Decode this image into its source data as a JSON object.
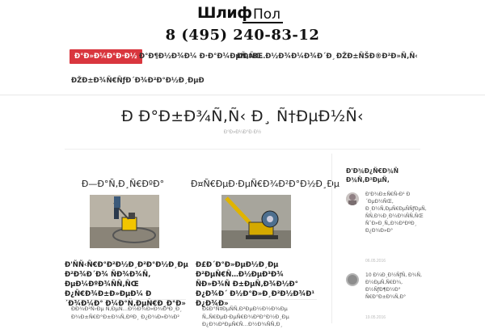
{
  "header": {
    "logo_left": "Шлиф",
    "logo_right": "Пол",
    "phone": "8 (495) 240-83-12"
  },
  "nav": [
    {
      "label": "Ð°Ð»Ð¼Ð°Ð·Ð½",
      "active": true
    },
    {
      "label": "Ð°Ð¶Ð½Ð¾Ð¼ Ð·Ð°Ð¼ÐµÑ‚ÑŒ",
      "active": false
    },
    {
      "label": "ÐÐ¤Ð…Ð½Ð¾Ð¼Ð¾Ð´Ð¸",
      "active": false
    },
    {
      "label": "ÐŽÐ±ÑŠÐ®Ð²Ð»Ñ‚Ñ‹",
      "active": false
    },
    {
      "label": "ÐŽÐ±Ð¾Ñ€ÑƒÐ´Ð¾Ð²Ð°Ð½Ð¸ÐµÐ",
      "active": false
    }
  ],
  "page": {
    "title": "Ð Ð°Ð±Ð¾Ñ‚Ñ‹ Ð¸ Ñ†ÐµÐ½Ñ‹",
    "breadcrumb": "Ð°Ð»Ð¼Ð°Ð·Ð½"
  },
  "cards": [
    {
      "title": "Ð—Ð°Ñ‚Ð¸Ñ€ÐºÐ°",
      "post_title": "Ð'ÑÑ‹Ñ€Ð°Ð²Ð½Ð¸Ð²Ð°Ð½Ð¸Ðµ Ð²Ð¾Ð´Ð¾ ÑÐ¾Ð¾Ñ‚ ÐµÐ¼ÐºÐ¾ÑÑ‚ÑŒ Ð¿Ñ€Ð¾Ð±Ð»ÐµÐ¼ Ð´Ð¾Ð¼Ð° Ð¼Ð°Ñ‚ÐµÑ€Ð¸Ð°Ð»",
      "excerpt": "ÐÐ¾Ð²Ñ‹Ðµ Ñ‚ÐµÑ…Ð½Ð¾Ð»Ð¾Ð³Ð¸Ð¸ Ð¾Ð±Ñ€Ð°Ð±Ð¾Ñ‚ÐºÐ¸ Ð¿Ð¾Ð»Ð¾Ð²"
    },
    {
      "title": "Ð¤Ñ€ÐµÐ·ÐµÑ€Ð¾Ð²Ð°Ð½Ð¸Ðµ",
      "post_title": "Ð£Ð´Ð°Ð»ÐµÐ½Ð¸Ðµ Ð²ÐµÑ€Ñ…Ð½ÐµÐ³Ð¾ ÑÐ»Ð¾Ñ Ð±ÐµÑ‚Ð¾Ð½Ð° Ð¿Ð¾Ð´ Ð½Ð°Ð»Ð¸Ð²Ð½Ð¾Ð¹ Ð¿Ð¾Ð»",
      "excerpt": "ÐšÐ°Ñ‡ÐµÑÑ‚Ð²ÐµÐ½Ð½Ð¾Ðµ Ñ„Ñ€ÐµÐ·ÐµÑ€Ð¾Ð²Ð°Ð½Ð¸Ðµ Ð¿Ð¾Ð²ÐµÑ€Ñ…Ð½Ð¾ÑÑ‚Ð¸"
    }
  ],
  "sidebar": {
    "widget_title": "Ð'Ð¾Ð¿Ñ€Ð¾Ñ Ð¾Ñ‚Ð²ÐµÑ‚",
    "comments": [
      {
        "text": "Ð'Ð¾Ð±Ñ€Ñ‹Ð¹ Ð´ÐµÐ½ÑŒ, Ð¸Ð½Ñ‚ÐµÑ€ÐµÑÑƒÐµÑ‚ ÑÑ‚Ð¾Ð¸Ð¼Ð¾ÑÑ‚ÑŒ ÑˆÐ»Ð¸Ñ„Ð¾Ð²ÐºÐ¸ Ð¿Ð¾Ð»Ð°",
        "date": "06.05.2016"
      },
      {
        "text": "10 Ð¼Ð¸Ð½ÑƒÑ‚ Ð¾Ñ‚ Ð¼ÐµÑ‚Ñ€Ð¾, Ð½ÑƒÐ¶Ð½Ð° Ñ€Ð°Ð±Ð¾Ñ‚Ð°",
        "date": "19.05.2016"
      }
    ]
  },
  "colors": {
    "accent": "#d9363e"
  }
}
